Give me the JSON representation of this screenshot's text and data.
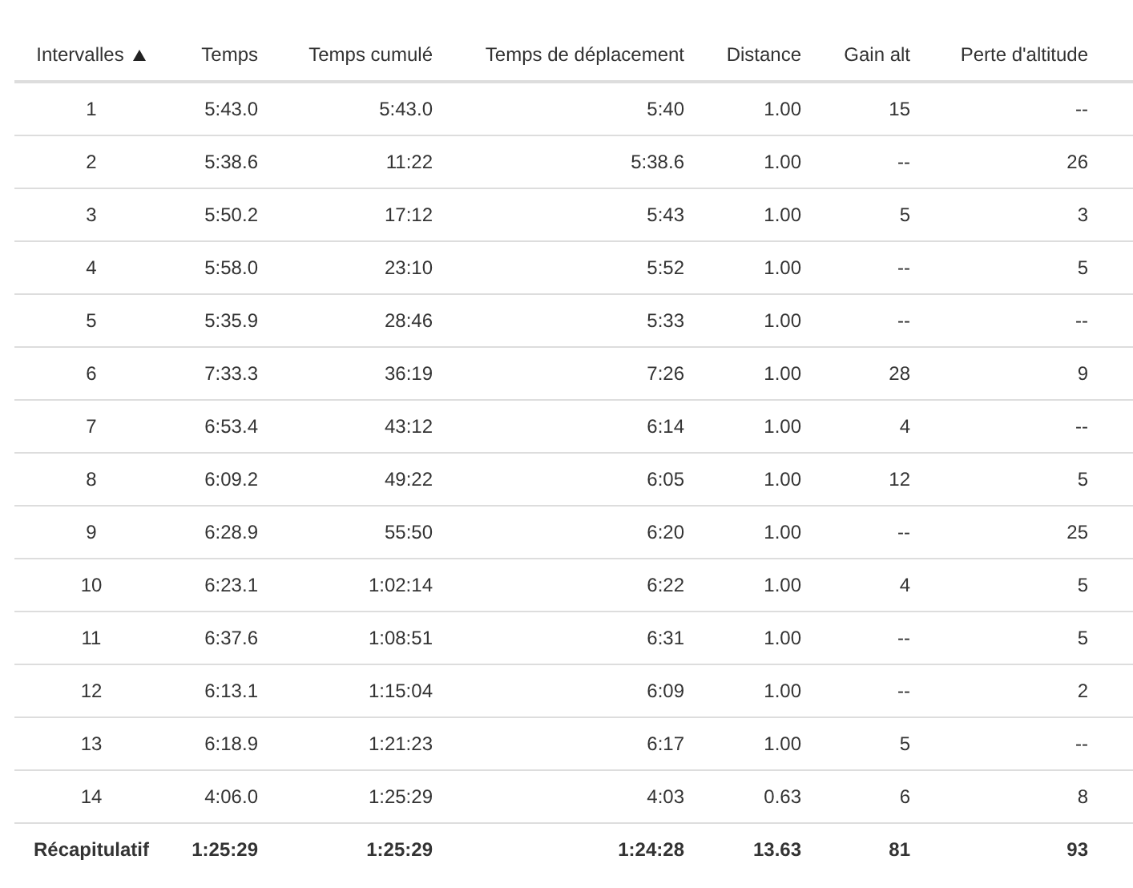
{
  "table": {
    "columns": [
      {
        "label": "Intervalles",
        "sorted": true
      },
      {
        "label": "Temps",
        "sorted": false
      },
      {
        "label": "Temps cumulé",
        "sorted": false
      },
      {
        "label": "Temps de déplacement",
        "sorted": false
      },
      {
        "label": "Distance",
        "sorted": false
      },
      {
        "label": "Gain alt",
        "sorted": false
      },
      {
        "label": "Perte d'altitude",
        "sorted": false
      }
    ],
    "rows": [
      [
        "1",
        "5:43.0",
        "5:43.0",
        "5:40",
        "1.00",
        "15",
        "--"
      ],
      [
        "2",
        "5:38.6",
        "11:22",
        "5:38.6",
        "1.00",
        "--",
        "26"
      ],
      [
        "3",
        "5:50.2",
        "17:12",
        "5:43",
        "1.00",
        "5",
        "3"
      ],
      [
        "4",
        "5:58.0",
        "23:10",
        "5:52",
        "1.00",
        "--",
        "5"
      ],
      [
        "5",
        "5:35.9",
        "28:46",
        "5:33",
        "1.00",
        "--",
        "--"
      ],
      [
        "6",
        "7:33.3",
        "36:19",
        "7:26",
        "1.00",
        "28",
        "9"
      ],
      [
        "7",
        "6:53.4",
        "43:12",
        "6:14",
        "1.00",
        "4",
        "--"
      ],
      [
        "8",
        "6:09.2",
        "49:22",
        "6:05",
        "1.00",
        "12",
        "5"
      ],
      [
        "9",
        "6:28.9",
        "55:50",
        "6:20",
        "1.00",
        "--",
        "25"
      ],
      [
        "10",
        "6:23.1",
        "1:02:14",
        "6:22",
        "1.00",
        "4",
        "5"
      ],
      [
        "11",
        "6:37.6",
        "1:08:51",
        "6:31",
        "1.00",
        "--",
        "5"
      ],
      [
        "12",
        "6:13.1",
        "1:15:04",
        "6:09",
        "1.00",
        "--",
        "2"
      ],
      [
        "13",
        "6:18.9",
        "1:21:23",
        "6:17",
        "1.00",
        "5",
        "--"
      ],
      [
        "14",
        "4:06.0",
        "1:25:29",
        "4:03",
        "0.63",
        "6",
        "8"
      ]
    ],
    "summary": [
      "Récapitulatif",
      "1:25:29",
      "1:25:29",
      "1:24:28",
      "13.63",
      "81",
      "93"
    ]
  }
}
